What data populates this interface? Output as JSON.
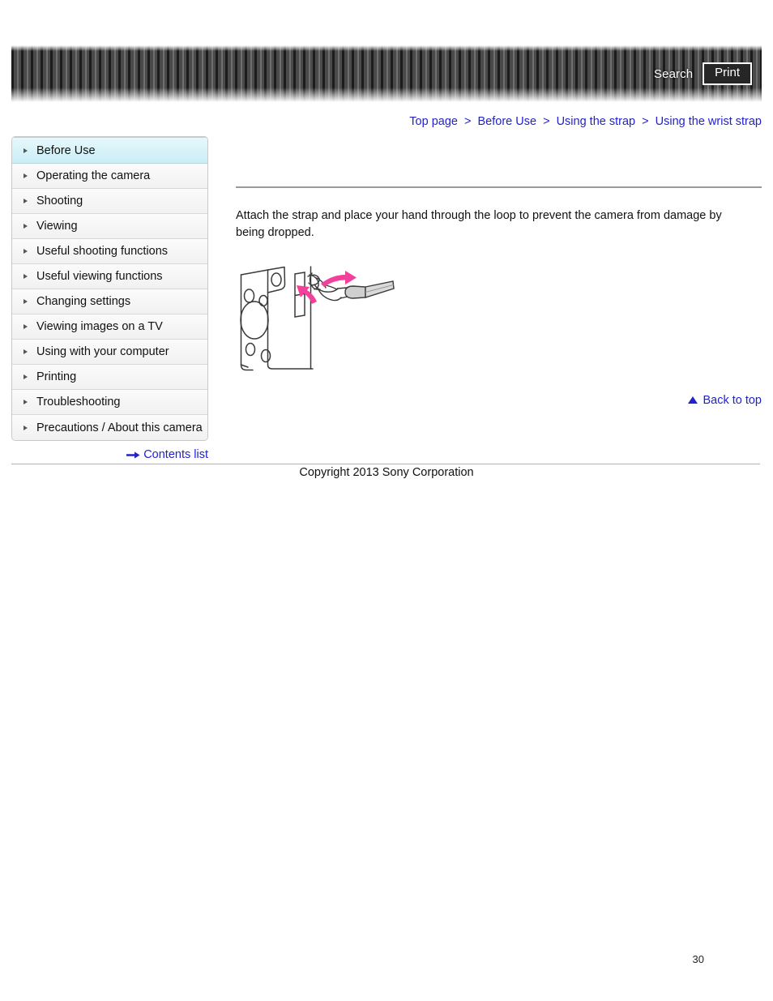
{
  "header": {
    "search_label": "Search",
    "print_label": "Print",
    "banner_dark_color": "#1c1c1c",
    "banner_light_color": "#6f6f6f"
  },
  "breadcrumb": {
    "separator": ">",
    "items": [
      {
        "label": "Top page"
      },
      {
        "label": "Before Use"
      },
      {
        "label": "Using the strap"
      },
      {
        "label": "Using the wrist strap"
      }
    ],
    "link_color": "#2222cc"
  },
  "sidebar": {
    "items": [
      {
        "label": "Before Use",
        "active": true
      },
      {
        "label": "Operating the camera",
        "active": false
      },
      {
        "label": "Shooting",
        "active": false
      },
      {
        "label": "Viewing",
        "active": false
      },
      {
        "label": "Useful shooting functions",
        "active": false
      },
      {
        "label": "Useful viewing functions",
        "active": false
      },
      {
        "label": "Changing settings",
        "active": false
      },
      {
        "label": "Viewing images on a TV",
        "active": false
      },
      {
        "label": "Using with your computer",
        "active": false
      },
      {
        "label": "Printing",
        "active": false
      },
      {
        "label": "Troubleshooting",
        "active": false
      },
      {
        "label": "Precautions / About this camera",
        "active": false
      }
    ],
    "active_color": "#c9eef5",
    "contents_list_label": "Contents list",
    "contents_list_icon": "right-arrow-icon"
  },
  "main": {
    "body_text": "Attach the strap and place your hand through the loop to prevent the camera from damage by being dropped.",
    "illustration": {
      "name": "wrist-strap-attachment-diagram",
      "description": "Line drawing of camera body side with wrist strap threaded through the strap eyelet",
      "arrow_color": "#f4409a",
      "line_color": "#3a3a3a"
    }
  },
  "back_to_top": {
    "label": "Back to top",
    "icon": "triangle-up-icon",
    "color": "#2222cc"
  },
  "footer": {
    "copyright": "Copyright 2013 Sony Corporation",
    "page_number": "30"
  }
}
